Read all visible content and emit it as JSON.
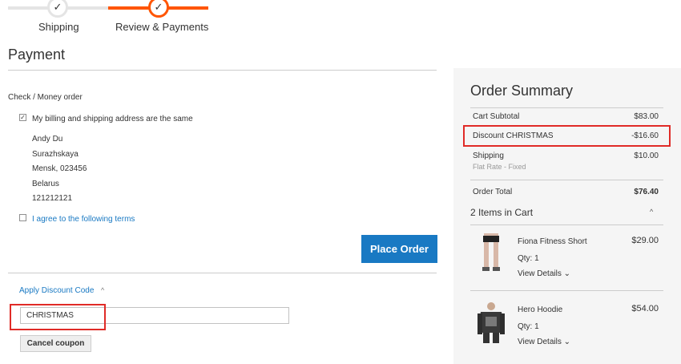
{
  "progress": {
    "steps": [
      {
        "label": "Shipping",
        "icon": "checkmark-icon",
        "state": "complete"
      },
      {
        "label": "Review & Payments",
        "icon": "checkmark-icon",
        "state": "active"
      }
    ],
    "check_glyph": "✓",
    "active_color": "#ff5501"
  },
  "payment": {
    "title": "Payment",
    "method_title": "Check / Money order",
    "billing_same_label": "My billing and shipping address are the same",
    "billing_same_checked": true,
    "address_lines": [
      "Andy Du",
      "Surazhskaya",
      "Mensk, 023456",
      "Belarus",
      "121212121"
    ],
    "terms_label": "I agree to the following terms",
    "place_order_label": "Place Order",
    "discount": {
      "toggle_label": "Apply Discount Code",
      "chevron": "^",
      "code_value": "CHRISTMAS",
      "cancel_label": "Cancel coupon"
    }
  },
  "summary": {
    "title": "Order Summary",
    "rows": {
      "subtotal": {
        "label": "Cart Subtotal",
        "value": "$83.00"
      },
      "discount": {
        "label": "Discount CHRISTMAS",
        "value": "-$16.60"
      },
      "shipping": {
        "label": "Shipping",
        "value": "$10.00",
        "sublabel": "Flat Rate - Fixed"
      },
      "total": {
        "label": "Order Total",
        "value": "$76.40"
      }
    },
    "items_title": "2 Items in Cart",
    "items_chevron": "^",
    "items": [
      {
        "name": "Fiona Fitness Short",
        "price": "$29.00",
        "qty": "Qty: 1",
        "details": "View Details",
        "details_chevron": "⌄"
      },
      {
        "name": "Hero Hoodie",
        "price": "$54.00",
        "qty": "Qty: 1",
        "details": "View Details",
        "details_chevron": "⌄"
      }
    ]
  },
  "colors": {
    "primary": "#1979c3",
    "highlight": "#e02b27",
    "summary_bg": "#f5f5f5"
  }
}
